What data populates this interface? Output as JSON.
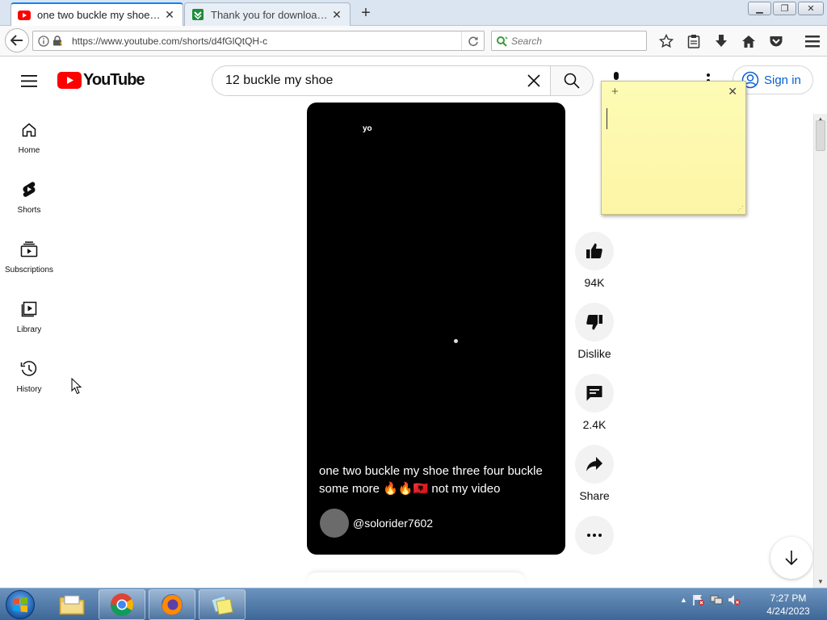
{
  "browser": {
    "tabs": [
      {
        "title": "one two buckle my shoe th...",
        "active": true
      },
      {
        "title": "Thank you for downloadin...",
        "active": false
      }
    ],
    "url": "https://www.youtube.com/shorts/d4fGlQtQH-c",
    "search_placeholder": "Search"
  },
  "youtube": {
    "logo_text": "YouTube",
    "search_query": "12 buckle my shoe",
    "sign_in_label": "Sign in",
    "guide": [
      {
        "label": "Home"
      },
      {
        "label": "Shorts"
      },
      {
        "label": "Subscriptions"
      },
      {
        "label": "Library"
      },
      {
        "label": "History"
      }
    ],
    "video": {
      "overlay_text": "yo",
      "caption": "one two buckle my shoe three four buckle some more 🔥🔥🇦🇱 not my video",
      "channel_handle": "@solorider7602"
    },
    "actions": {
      "like_count": "94K",
      "dislike_label": "Dislike",
      "comment_count": "2.4K",
      "share_label": "Share"
    }
  },
  "taskbar": {
    "time": "7:27 PM",
    "date": "4/24/2023"
  },
  "colors": {
    "youtube_red": "#ff0000",
    "signin_blue": "#065fd4",
    "tab_accent": "#0a84ff",
    "sticky_yellow": "#fdfbb5"
  }
}
